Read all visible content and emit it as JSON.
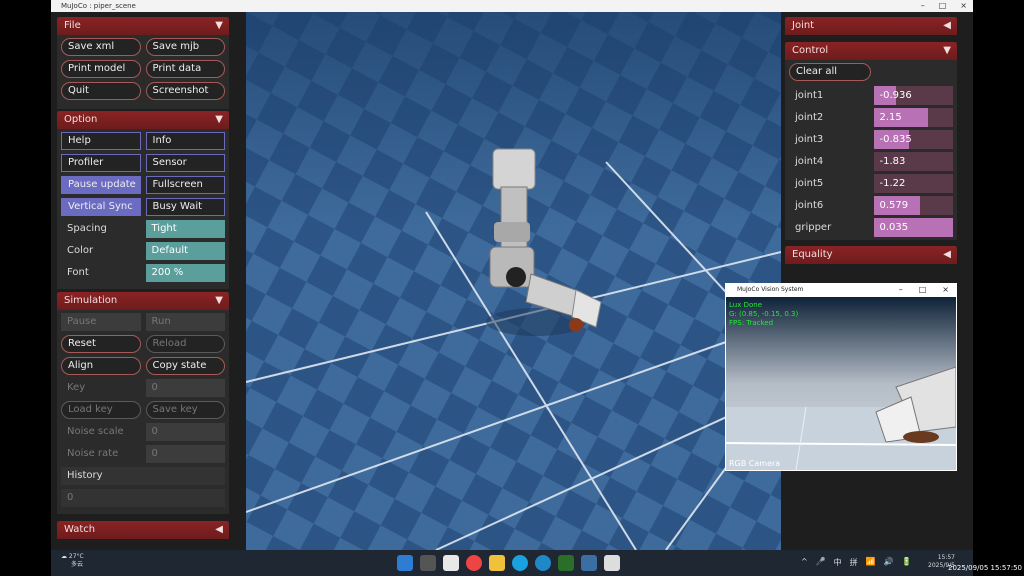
{
  "window": {
    "title": "MuJoCo : piper_scene",
    "controls": [
      "–",
      "□",
      "×"
    ]
  },
  "left_panel": {
    "file": {
      "header": "File",
      "buttons": [
        "Save xml",
        "Save mjb",
        "Print model",
        "Print data",
        "Quit",
        "Screenshot"
      ]
    },
    "option": {
      "header": "Option",
      "checkboxes": [
        {
          "label": "Help",
          "on": false
        },
        {
          "label": "Info",
          "on": false
        },
        {
          "label": "Profiler",
          "on": false
        },
        {
          "label": "Sensor",
          "on": false
        },
        {
          "label": "Pause update",
          "on": true
        },
        {
          "label": "Fullscreen",
          "on": false
        },
        {
          "label": "Vertical Sync",
          "on": true
        },
        {
          "label": "Busy Wait",
          "on": false
        }
      ],
      "spacing_label": "Spacing",
      "spacing_value": "Tight",
      "color_label": "Color",
      "color_value": "Default",
      "font_label": "Font",
      "font_value": "200 %"
    },
    "simulation": {
      "header": "Simulation",
      "pause": "Pause",
      "run": "Run",
      "reset": "Reset",
      "reload": "Reload",
      "align": "Align",
      "copy_state": "Copy state",
      "key_label": "Key",
      "key_value": "0",
      "load_key": "Load key",
      "save_key": "Save key",
      "noise_scale_label": "Noise scale",
      "noise_scale_value": "0",
      "noise_rate_label": "Noise rate",
      "noise_rate_value": "0",
      "history_label": "History",
      "history_value": "0"
    },
    "watch": {
      "header": "Watch"
    }
  },
  "right_panel": {
    "joint": {
      "header": "Joint"
    },
    "control": {
      "header": "Control",
      "clear_all": "Clear all",
      "joints": [
        {
          "name": "joint1",
          "value": "-0.936",
          "fill": 0.28
        },
        {
          "name": "joint2",
          "value": "2.15",
          "fill": 0.68
        },
        {
          "name": "joint3",
          "value": "-0.835",
          "fill": 0.45
        },
        {
          "name": "joint4",
          "value": "-1.83",
          "fill": 0.0
        },
        {
          "name": "joint5",
          "value": "-1.22",
          "fill": 0.0
        },
        {
          "name": "joint6",
          "value": "0.579",
          "fill": 0.58
        },
        {
          "name": "gripper",
          "value": "0.035",
          "fill": 1.0
        }
      ]
    },
    "equality": {
      "header": "Equality"
    }
  },
  "vision_window": {
    "title": "MuJoCo Vision System",
    "overlay_lines": [
      "Lux Done",
      "G: (0.85, -0.15, 0.3)",
      "FPS: Tracked"
    ],
    "camera_label": "RGB Camera"
  },
  "taskbar": {
    "weather_temp": "27°C",
    "weather_desc": "多云",
    "tray_icons": [
      "^",
      "🎤",
      "中",
      "拼",
      "📶",
      "🔊",
      "🔋"
    ],
    "time": "15:57",
    "date": "2025/9/5"
  },
  "timestamp_overlay": "2025/09/05 15:57:50",
  "colors": {
    "header_red": "#8a2324",
    "checkbox_on": "#6b6bc2",
    "select_teal": "#5a9f9b",
    "slider_fill": "#b871b4"
  }
}
